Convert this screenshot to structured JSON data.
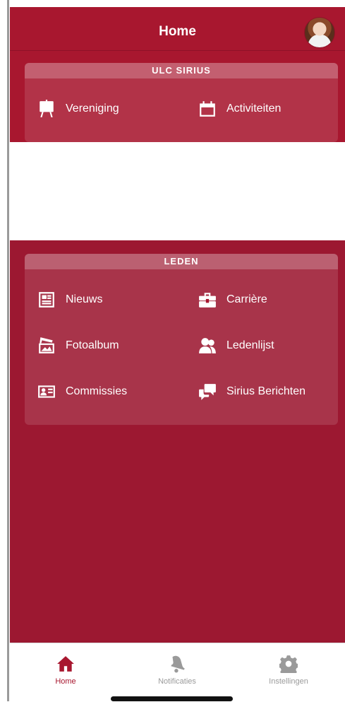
{
  "header": {
    "title": "Home",
    "avatar_icon": "profile-photo"
  },
  "sections": [
    {
      "title": "ULC SIRIUS",
      "items": [
        {
          "label": "Vereniging",
          "icon": "easel-icon"
        },
        {
          "label": "Activiteiten",
          "icon": "calendar-icon"
        }
      ]
    },
    {
      "title": "LEDEN",
      "items": [
        {
          "label": "Nieuws",
          "icon": "newspaper-icon"
        },
        {
          "label": "Carrière",
          "icon": "briefcase-icon"
        },
        {
          "label": "Fotoalbum",
          "icon": "photo-album-icon"
        },
        {
          "label": "Ledenlijst",
          "icon": "users-icon"
        },
        {
          "label": "Commissies",
          "icon": "id-card-icon"
        },
        {
          "label": "Sirius Berichten",
          "icon": "chat-bubbles-icon"
        }
      ]
    }
  ],
  "banner_text": "",
  "tabbar": {
    "tabs": [
      {
        "label": "Home",
        "icon": "home-icon",
        "active": true
      },
      {
        "label": "Notificaties",
        "icon": "bell-icon",
        "active": false
      },
      {
        "label": "Instellingen",
        "icon": "gear-icon",
        "active": false
      }
    ]
  },
  "colors": {
    "primary": "#a8172f",
    "background_red": "#9c1831",
    "inactive_tab": "#9a9a9a"
  }
}
